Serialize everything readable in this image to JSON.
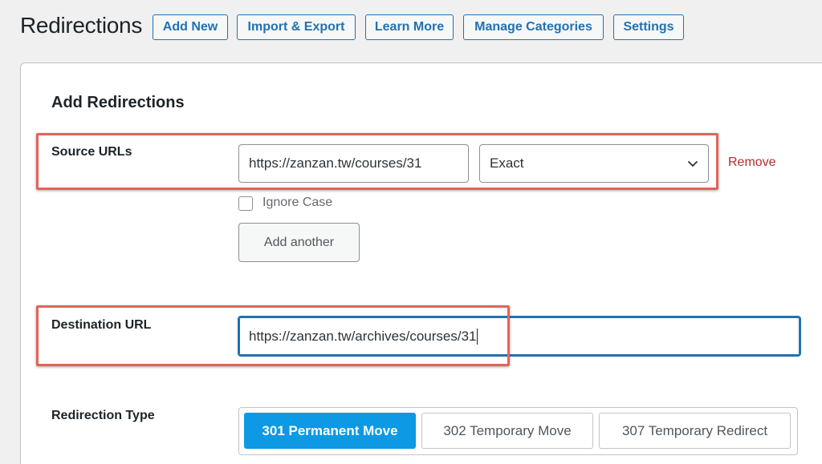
{
  "header": {
    "title": "Redirections",
    "buttons": {
      "add_new": "Add New",
      "import_export": "Import & Export",
      "learn_more": "Learn More",
      "manage_categories": "Manage Categories",
      "settings": "Settings"
    }
  },
  "form": {
    "heading": "Add Redirections",
    "source": {
      "label": "Source URLs",
      "url_value": "https://zanzan.tw/courses/31",
      "match_type": "Exact",
      "remove_label": "Remove",
      "ignore_case_label": "Ignore Case",
      "ignore_case_checked": false,
      "add_another_label": "Add another"
    },
    "destination": {
      "label": "Destination URL",
      "url_value": "https://zanzan.tw/archives/courses/31"
    },
    "redirection_type": {
      "label": "Redirection Type",
      "options": [
        "301 Permanent Move",
        "302 Temporary Move",
        "307 Temporary Redirect"
      ],
      "selected": "301 Permanent Move"
    }
  },
  "colors": {
    "accent": "#2271b1",
    "active_segment": "#0d99e3",
    "remove": "#b32d2e",
    "highlight": "#e4635a"
  }
}
